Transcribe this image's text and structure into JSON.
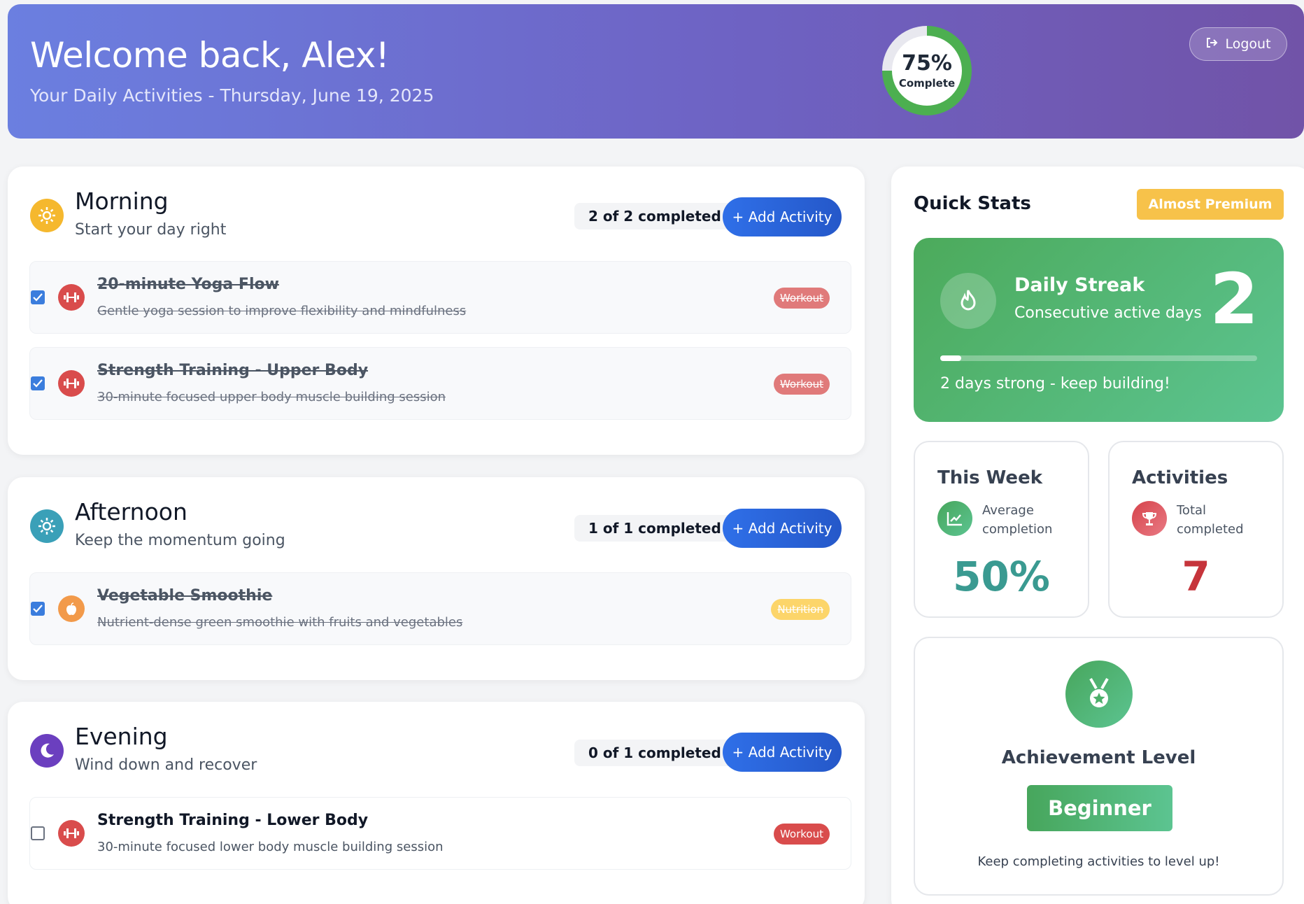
{
  "header": {
    "welcome": "Welcome back, Alex!",
    "subtitle": "Your Daily Activities - Thursday, June 19, 2025",
    "progress_percent": "75%",
    "progress_value": 0.75,
    "progress_label": "Complete",
    "logout_label": "Logout"
  },
  "periods": [
    {
      "title": "Morning",
      "subtitle": "Start your day right",
      "count": "2 of 2 completed",
      "add_label": "+ Add Activity",
      "icon": "sun-icon",
      "color": "#f5b82e",
      "activities": [
        {
          "title": "20-minute Yoga Flow",
          "description": "Gentle yoga session to improve flexibility and mindfulness",
          "tag": "Workout",
          "checked": true,
          "icon": "dumbbell-icon"
        },
        {
          "title": "Strength Training - Upper Body",
          "description": "30-minute focused upper body muscle building session",
          "tag": "Workout",
          "checked": true,
          "icon": "dumbbell-icon"
        }
      ]
    },
    {
      "title": "Afternoon",
      "subtitle": "Keep the momentum going",
      "count": "1 of 1 completed",
      "add_label": "+ Add Activity",
      "icon": "sun-icon",
      "color": "#3aa0b8",
      "activities": [
        {
          "title": "Vegetable Smoothie",
          "description": "Nutrient-dense green smoothie with fruits and vegetables",
          "tag": "Nutrition",
          "checked": true,
          "icon": "apple-icon"
        }
      ]
    },
    {
      "title": "Evening",
      "subtitle": "Wind down and recover",
      "count": "0 of 1 completed",
      "add_label": "+ Add Activity",
      "icon": "moon-icon",
      "color": "#6b3fbf",
      "activities": [
        {
          "title": "Strength Training - Lower Body",
          "description": "30-minute focused lower body muscle building session",
          "tag": "Workout",
          "checked": false,
          "icon": "dumbbell-icon"
        }
      ]
    }
  ],
  "sidebar": {
    "title": "Quick Stats",
    "badge": "Almost Premium",
    "streak": {
      "title": "Daily Streak",
      "subtitle": "Consecutive active days",
      "value": "2",
      "progress": 0.067,
      "note": "2 days strong - keep building!"
    },
    "week": {
      "title": "This Week",
      "label": "Average completion",
      "value": "50%",
      "color": "#3a9a91"
    },
    "activities": {
      "title": "Activities",
      "label": "Total completed",
      "value": "7",
      "color": "#c6343b"
    },
    "achievement": {
      "title": "Achievement Level",
      "level": "Beginner",
      "note": "Keep completing activities to level up!"
    }
  }
}
